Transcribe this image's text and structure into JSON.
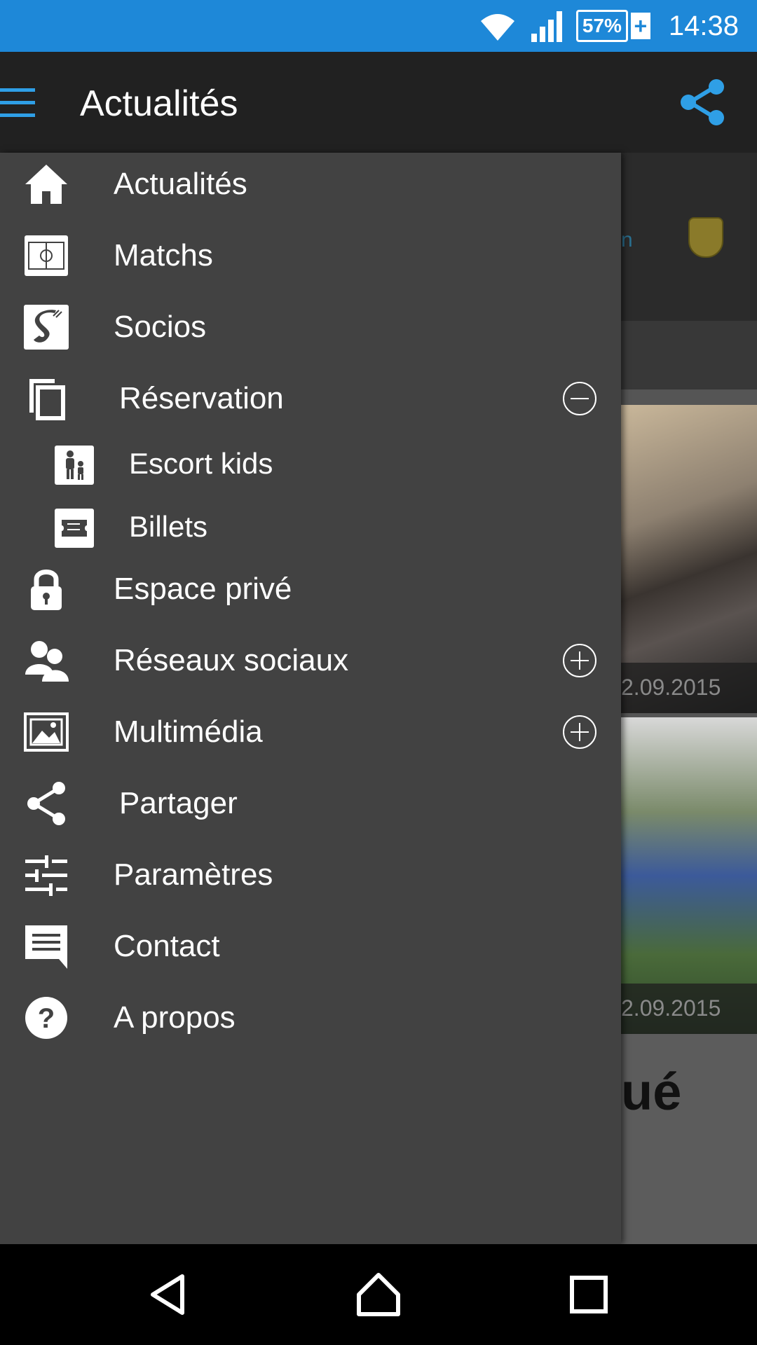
{
  "status_bar": {
    "battery": "57%",
    "time": "14:38"
  },
  "app_bar": {
    "title": "Actualités"
  },
  "background": {
    "date_1": "2.09.2015",
    "date_2": "2.09.2015",
    "headline_fragment": "ué"
  },
  "drawer": {
    "items": [
      {
        "label": "Actualités",
        "icon": "home-icon"
      },
      {
        "label": "Matchs",
        "icon": "field-icon"
      },
      {
        "label": "Socios",
        "icon": "socios-icon"
      },
      {
        "label": "Réservation",
        "icon": "copy-icon",
        "toggle": "collapse"
      },
      {
        "label": "Escort kids",
        "icon": "family-icon"
      },
      {
        "label": "Billets",
        "icon": "ticket-icon"
      },
      {
        "label": "Espace privé",
        "icon": "lock-icon"
      },
      {
        "label": "Réseaux sociaux",
        "icon": "people-icon",
        "toggle": "expand"
      },
      {
        "label": "Multimédia",
        "icon": "image-icon",
        "toggle": "expand"
      },
      {
        "label": "Partager",
        "icon": "share-icon"
      },
      {
        "label": "Paramètres",
        "icon": "sliders-icon"
      },
      {
        "label": "Contact",
        "icon": "message-icon"
      },
      {
        "label": "A propos",
        "icon": "help-icon"
      }
    ]
  },
  "colors": {
    "status_bar": "#1e88d8",
    "accent": "#2f9fe6",
    "drawer_bg": "#424242",
    "app_bar": "#212121"
  }
}
